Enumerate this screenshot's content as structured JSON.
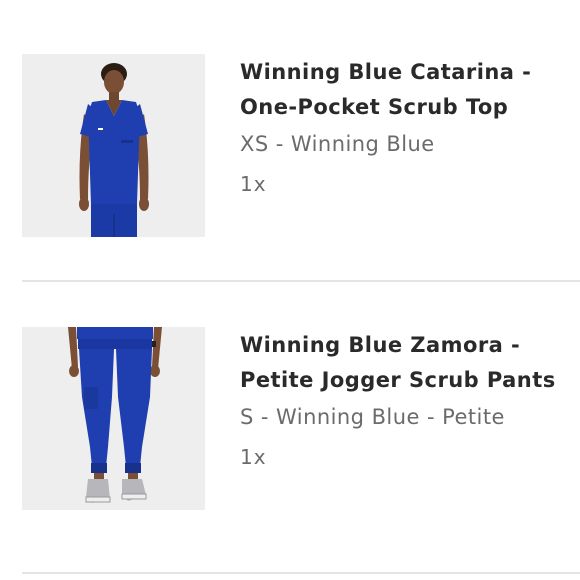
{
  "cart": {
    "items": [
      {
        "title_line1": "Winning Blue Catarina -",
        "title_line2": "One-Pocket Scrub Top",
        "variant": "XS - Winning Blue",
        "quantity": "1x",
        "image_icon": "scrub-top-photo",
        "product_color": "#1f3fb0"
      },
      {
        "title_line1": "Winning Blue Zamora -",
        "title_line2": "Petite Jogger Scrub Pants",
        "variant": "S - Winning Blue - Petite",
        "quantity": "1x",
        "image_icon": "scrub-pants-photo",
        "product_color": "#1f3fb0"
      }
    ]
  }
}
